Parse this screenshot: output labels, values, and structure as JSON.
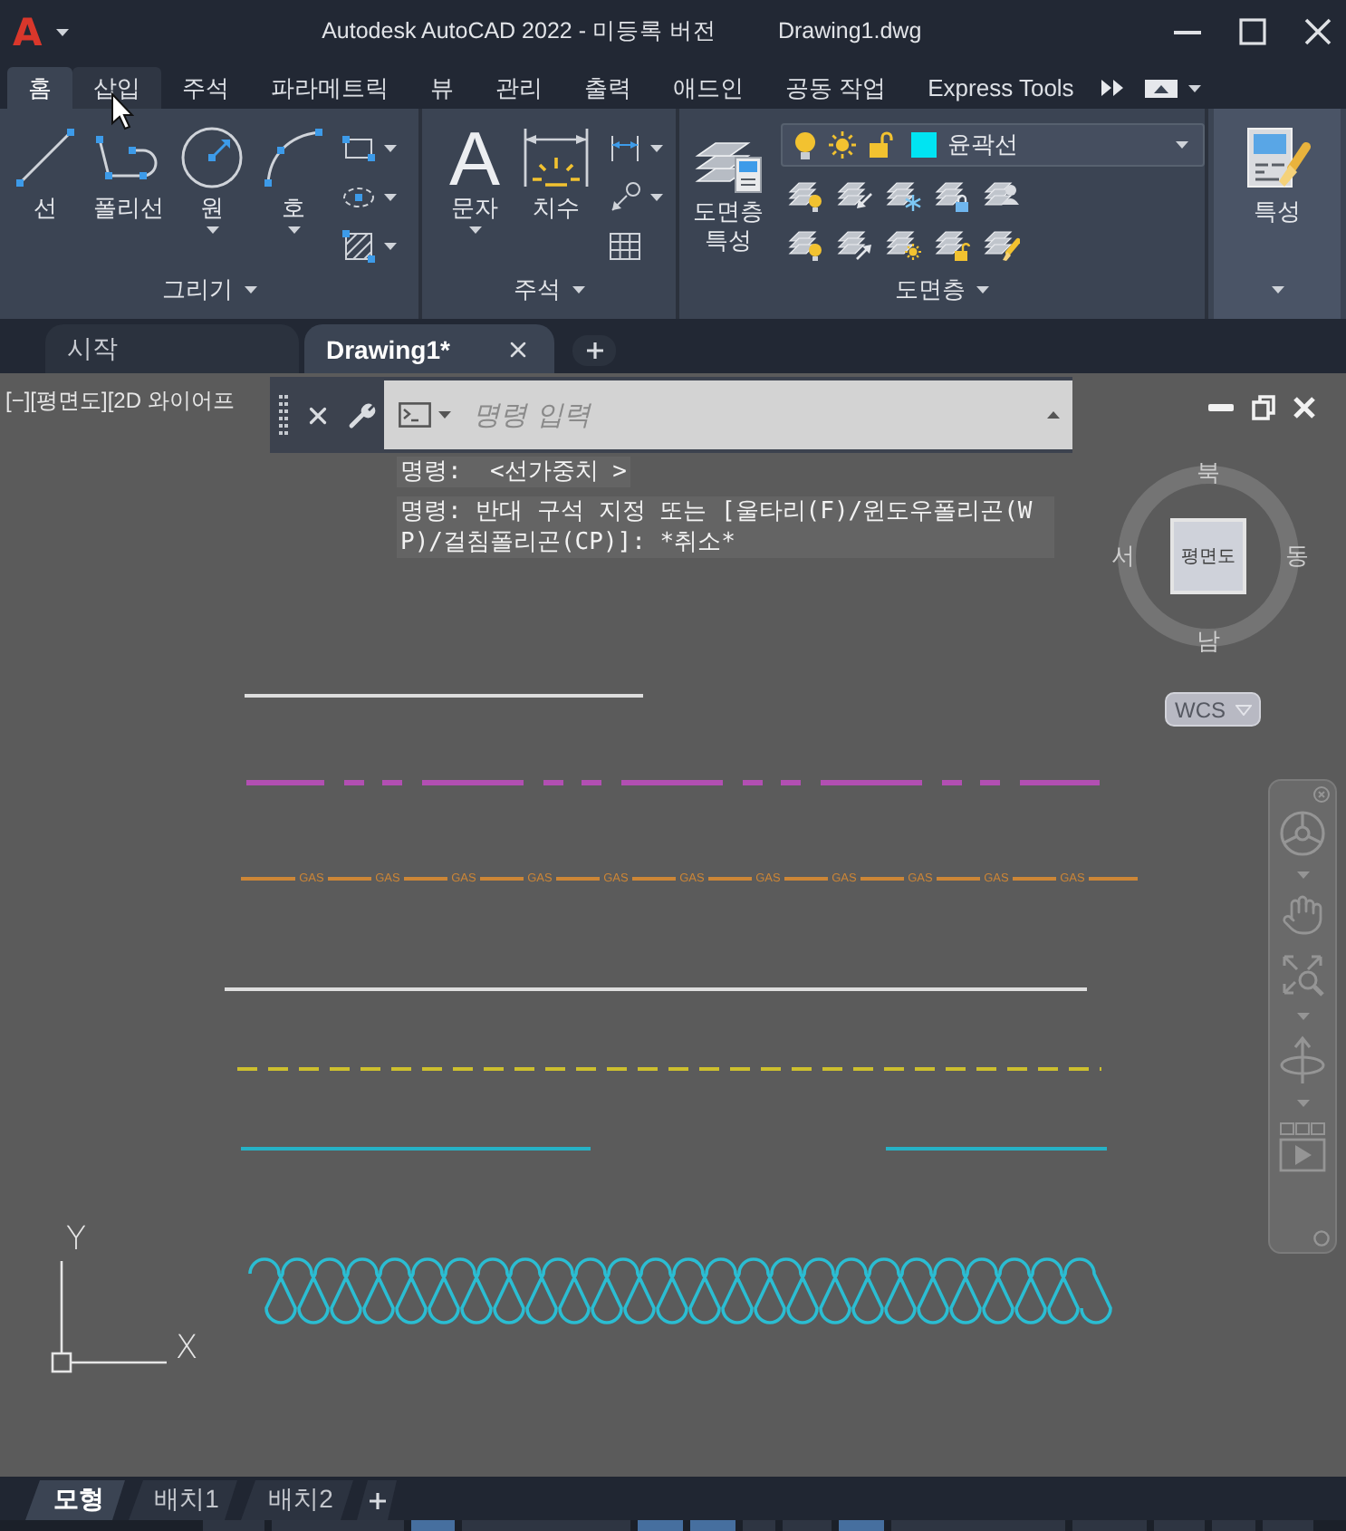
{
  "title_bar": {
    "logo": "A",
    "app_title": "Autodesk AutoCAD 2022 - 미등록 버전",
    "file_name": "Drawing1.dwg"
  },
  "ribbon_tabs": [
    {
      "label": "홈",
      "selected": true,
      "hovered": false
    },
    {
      "label": "삽입",
      "selected": false,
      "hovered": true
    },
    {
      "label": "주석",
      "selected": false,
      "hovered": false
    },
    {
      "label": "파라메트릭",
      "selected": false,
      "hovered": false
    },
    {
      "label": "뷰",
      "selected": false,
      "hovered": false
    },
    {
      "label": "관리",
      "selected": false,
      "hovered": false
    },
    {
      "label": "출력",
      "selected": false,
      "hovered": false
    },
    {
      "label": "애드인",
      "selected": false,
      "hovered": false
    },
    {
      "label": "공동 작업",
      "selected": false,
      "hovered": false
    },
    {
      "label": "Express Tools",
      "selected": false,
      "hovered": false
    }
  ],
  "ribbon_panels": [
    {
      "kind": "draw",
      "title": "그리기",
      "tools": [
        {
          "kind": "line",
          "label": "선",
          "has_menu": false
        },
        {
          "kind": "polyline",
          "label": "폴리선",
          "has_menu": false
        },
        {
          "kind": "circle",
          "label": "원",
          "has_menu": true
        },
        {
          "kind": "arc",
          "label": "호",
          "has_menu": true
        }
      ]
    },
    {
      "kind": "annotation",
      "title": "주석",
      "tools": [
        {
          "kind": "text",
          "glyph": "A",
          "label": "문자",
          "has_menu": true
        },
        {
          "kind": "dimension",
          "label": "치수",
          "has_menu": false
        }
      ]
    },
    {
      "kind": "layers",
      "title": "도면층",
      "tools": [
        {
          "kind": "layer_properties",
          "label": "도면층 특성",
          "has_menu": false
        }
      ],
      "current_layer": {
        "name": "윤곽선",
        "color": "#00e4f2",
        "on": true,
        "frozen": false,
        "locked": false
      }
    },
    {
      "kind": "properties",
      "tools": [
        {
          "kind": "properties",
          "label": "특성",
          "has_menu": false
        }
      ]
    }
  ],
  "document_tabs": [
    {
      "label": "시작",
      "selected": false
    },
    {
      "label": "Drawing1*",
      "selected": true
    }
  ],
  "viewport": {
    "label": "[−][평면도][2D 와이어프",
    "ucs_button": "WCS"
  },
  "command_line": {
    "placeholder": "명령 입력",
    "history": [
      "명령:  <선가중치 >",
      "명령: 반대 구석 지정 또는 [울타리(F)/윈도우폴리곤(WP)/걸침폴리곤(CP)]: *취소*"
    ]
  },
  "viewcube": {
    "face": "평면도",
    "north": "북",
    "east": "동",
    "south": "남",
    "west": "서"
  },
  "drawing": {
    "lines": [
      {
        "kind": "solid",
        "color": "#dedede"
      },
      {
        "kind": "dash_dot_dot",
        "color": "#b24fb2"
      },
      {
        "kind": "gas",
        "color": "#cd8636",
        "labels": [
          "GAS",
          "GAS",
          "GAS",
          "GAS",
          "GAS",
          "GAS",
          "GAS",
          "GAS",
          "GAS",
          "GAS",
          "GAS"
        ]
      },
      {
        "kind": "solid",
        "color": "#dedede"
      },
      {
        "kind": "dashed",
        "color": "#cdbf2e"
      },
      {
        "kind": "gapped",
        "color": "#26b2c6"
      },
      {
        "kind": "batting",
        "color": "#2bbdd2"
      }
    ],
    "ucs": {
      "x_label": "X",
      "y_label": "Y"
    }
  },
  "layout_tabs": [
    {
      "label": "모형",
      "selected": true
    },
    {
      "label": "배치1",
      "selected": false
    },
    {
      "label": "배치2",
      "selected": false
    }
  ],
  "status_bar": {
    "buttons": [
      {
        "on": false
      },
      {
        "on": false
      },
      {
        "on": true
      },
      {
        "on": false
      },
      {
        "on": true
      },
      {
        "on": true
      },
      {
        "on": false
      },
      {
        "on": false
      },
      {
        "on": true
      },
      {
        "on": false
      },
      {
        "on": false
      },
      {
        "on": false
      },
      {
        "on": false
      },
      {
        "on": false
      }
    ]
  }
}
